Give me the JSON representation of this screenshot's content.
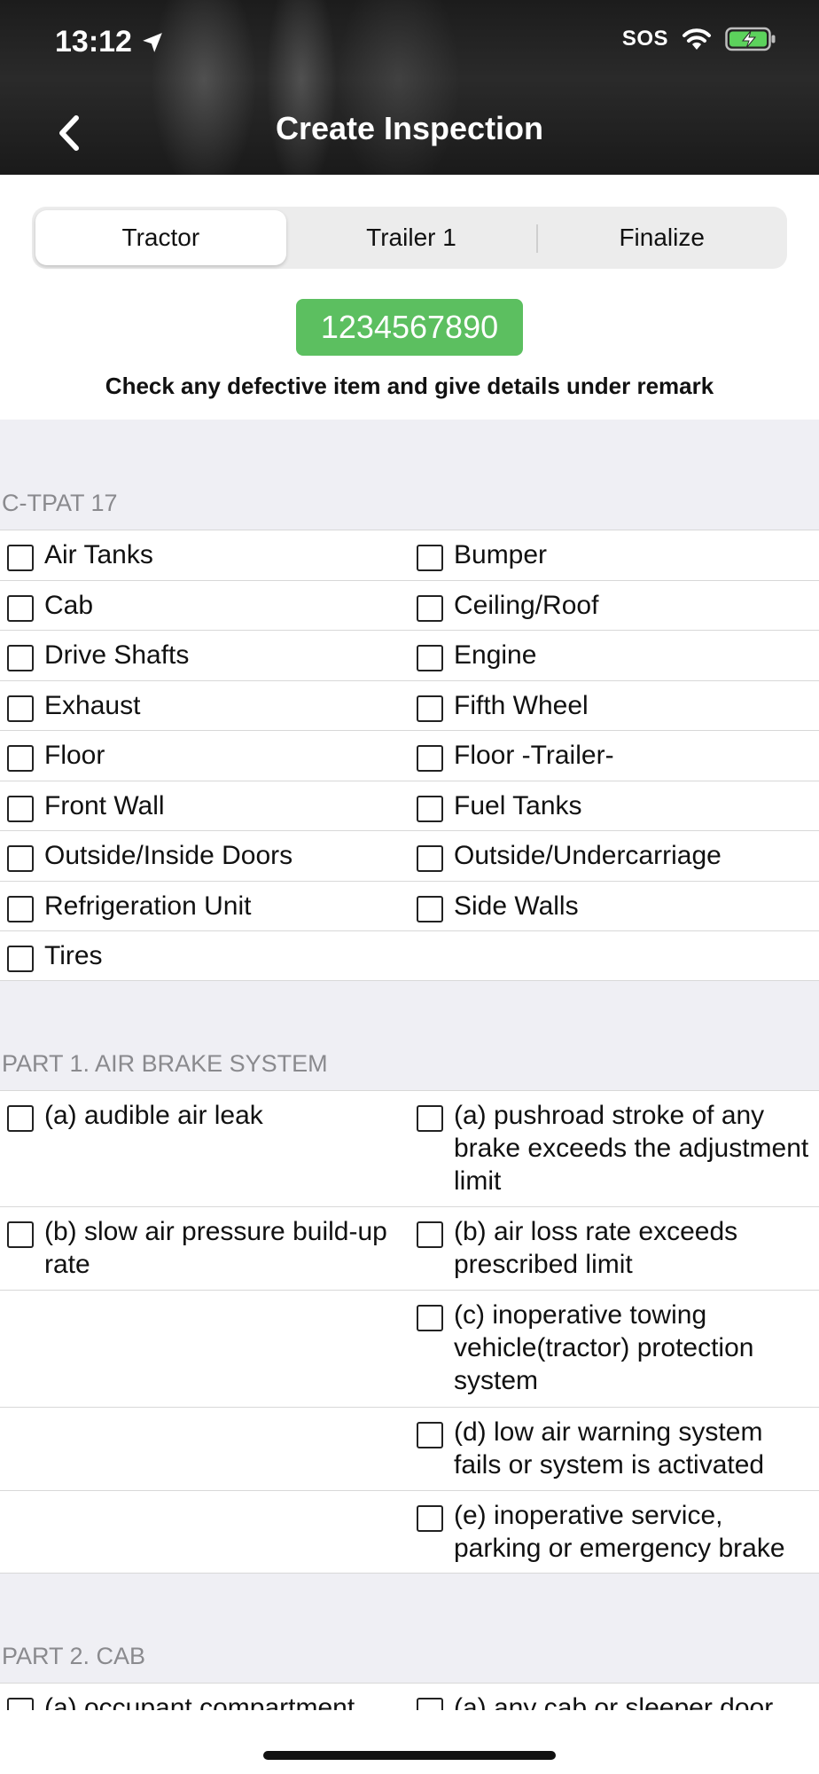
{
  "status_bar": {
    "time": "13:12",
    "sos": "SOS"
  },
  "header": {
    "title": "Create Inspection"
  },
  "tabs": [
    {
      "label": "Tractor",
      "active": true
    },
    {
      "label": "Trailer 1",
      "active": false
    },
    {
      "label": "Finalize",
      "active": false
    }
  ],
  "unit_badge": "1234567890",
  "instruction": "Check any defective item and give details under remark",
  "sections": {
    "ctpat": {
      "title": "C-TPAT 17",
      "items": [
        "Air Tanks",
        "Bumper",
        "Cab",
        "Ceiling/Roof",
        "Drive Shafts",
        "Engine",
        "Exhaust",
        "Fifth Wheel",
        "Floor",
        "Floor -Trailer-",
        "Front Wall",
        "Fuel Tanks",
        "Outside/Inside Doors",
        "Outside/Undercarriage",
        "Refrigeration Unit",
        "Side Walls",
        "Tires"
      ]
    },
    "part1": {
      "title": "PART 1. AIR BRAKE SYSTEM",
      "left": [
        "(a) audible air leak",
        "(b) slow air pressure build-up rate"
      ],
      "right": [
        "(a) pushroad stroke of any brake exceeds the adjustment limit",
        "(b) air loss rate exceeds prescribed limit",
        "(c) inoperative towing vehicle(tractor) protection system",
        "(d) low air warning system fails or system is activated",
        "(e) inoperative service, parking or emergency brake"
      ]
    },
    "part2": {
      "title": "PART 2. CAB",
      "left": [
        "(a) occupant compartment"
      ],
      "right": [
        "(a) any cab or sleeper door"
      ]
    }
  },
  "colors": {
    "badge": "#5cbf60",
    "list_bg": "#efeff4",
    "section_title": "#8a8a8e"
  }
}
